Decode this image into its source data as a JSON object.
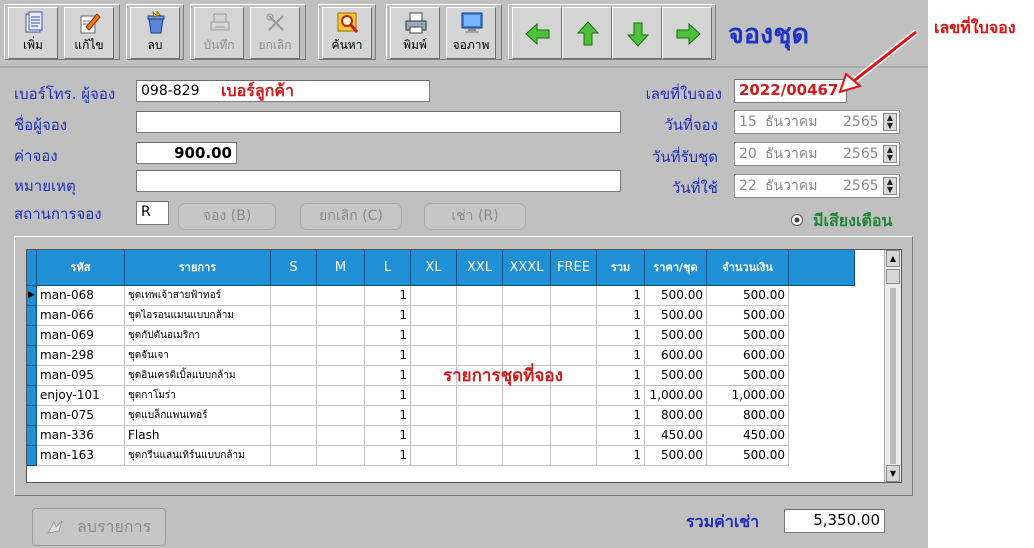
{
  "toolbar": {
    "buttons": [
      {
        "id": "add",
        "label": "เพิ่ม",
        "icon": "document-list-icon",
        "enabled": true
      },
      {
        "id": "edit",
        "label": "แก้ไข",
        "icon": "edit-pen-icon",
        "enabled": true
      },
      {
        "id": "delete",
        "label": "ลบ",
        "icon": "trash-can-icon",
        "enabled": true
      },
      {
        "id": "save",
        "label": "บันทึก",
        "icon": "printer-save-icon",
        "enabled": false
      },
      {
        "id": "cancel",
        "label": "ยกเลิก",
        "icon": "cross-tools-icon",
        "enabled": false
      },
      {
        "id": "search",
        "label": "ค้นหา",
        "icon": "magnifier-icon",
        "enabled": true
      },
      {
        "id": "print",
        "label": "พิมพ์",
        "icon": "printer-icon",
        "enabled": true
      },
      {
        "id": "screen",
        "label": "จอภาพ",
        "icon": "monitor-icon",
        "enabled": true
      }
    ],
    "nav": [
      {
        "id": "first",
        "icon": "arrow-left-icon"
      },
      {
        "id": "prev",
        "icon": "arrow-up-icon"
      },
      {
        "id": "next",
        "icon": "arrow-down-icon"
      },
      {
        "id": "last",
        "icon": "arrow-right-icon"
      }
    ]
  },
  "window_title": "จองชุด",
  "annotation": "เลขที่ใบจอง",
  "form": {
    "phone_label": "เบอร์โทร. ผู้จอง",
    "phone_value": "098-829",
    "phone_hint": "เบอร์ลูกค้า",
    "name_label": "ชื่อผู้จอง",
    "name_value": "",
    "deposit_label": "ค่าจอง",
    "deposit_value": "900.00",
    "note_label": "หมายเหตุ",
    "note_value": "",
    "status_label": "สถานการจอง",
    "status_value": "R",
    "btn_book": "จอง (B)",
    "btn_cancel": "ยกเลิก (C)",
    "btn_rent": "เช่า (R)",
    "doc_no_label": "เลขที่ใบจอง",
    "doc_no_value": "2022/00467",
    "date_book_label": "วันที่จอง",
    "date_book": {
      "day": "15",
      "month": "ธันวาคม",
      "year": "2565"
    },
    "date_pickup_label": "วันที่รับชุด",
    "date_pickup": {
      "day": "20",
      "month": "ธันวาคม",
      "year": "2565"
    },
    "date_use_label": "วันที่ใช้",
    "date_use": {
      "day": "22",
      "month": "ธันวาคม",
      "year": "2565"
    },
    "alert_label": "มีเสียงเตือน"
  },
  "grid": {
    "headers": [
      "รหัส",
      "รายการ",
      "S",
      "M",
      "L",
      "XL",
      "XXL",
      "XXXL",
      "FREE",
      "รวม",
      "ราคา/ชุด",
      "จำนวนเงิน"
    ],
    "rows": [
      {
        "code": "man-068",
        "name": "ชุดเทพเจ้าสายฟ้าทอร์",
        "S": "",
        "M": "",
        "L": "1",
        "XL": "",
        "XXL": "",
        "XXXL": "",
        "FREE": "",
        "total": "1",
        "price": "500.00",
        "amount": "500.00"
      },
      {
        "code": "man-066",
        "name": "ชุดไอรอนแมนแบบกล้าม",
        "S": "",
        "M": "",
        "L": "1",
        "XL": "",
        "XXL": "",
        "XXXL": "",
        "FREE": "",
        "total": "1",
        "price": "500.00",
        "amount": "500.00"
      },
      {
        "code": "man-069",
        "name": "ชุดกัปตันอเมริกา",
        "S": "",
        "M": "",
        "L": "1",
        "XL": "",
        "XXL": "",
        "XXXL": "",
        "FREE": "",
        "total": "1",
        "price": "500.00",
        "amount": "500.00"
      },
      {
        "code": "man-298",
        "name": "ชุดจันเจา",
        "S": "",
        "M": "",
        "L": "1",
        "XL": "",
        "XXL": "",
        "XXXL": "",
        "FREE": "",
        "total": "1",
        "price": "600.00",
        "amount": "600.00"
      },
      {
        "code": "man-095",
        "name": "ชุดอินเครดิเบิ้ลแบบกล้าม",
        "S": "",
        "M": "",
        "L": "1",
        "XL": "",
        "XXL": "",
        "XXXL": "",
        "FREE": "",
        "total": "1",
        "price": "500.00",
        "amount": "500.00"
      },
      {
        "code": "enjoy-101",
        "name": "ชุดกาโมร่า",
        "S": "",
        "M": "",
        "L": "1",
        "XL": "",
        "XXL": "",
        "XXXL": "",
        "FREE": "",
        "total": "1",
        "price": "1,000.00",
        "amount": "1,000.00"
      },
      {
        "code": "man-075",
        "name": "ชุดแบล็กแพนเทอร์",
        "S": "",
        "M": "",
        "L": "1",
        "XL": "",
        "XXL": "",
        "XXXL": "",
        "FREE": "",
        "total": "1",
        "price": "800.00",
        "amount": "800.00"
      },
      {
        "code": "man-336",
        "name": "Flash",
        "S": "",
        "M": "",
        "L": "1",
        "XL": "",
        "XXL": "",
        "XXXL": "",
        "FREE": "",
        "total": "1",
        "price": "450.00",
        "amount": "450.00"
      },
      {
        "code": "man-163",
        "name": "ชุดกรีนแลนเทิร์นแบบกล้าม",
        "S": "",
        "M": "",
        "L": "1",
        "XL": "",
        "XXL": "",
        "XXXL": "",
        "FREE": "",
        "total": "1",
        "price": "500.00",
        "amount": "500.00"
      }
    ],
    "overlay_label": "รายการชุดที่จอง"
  },
  "footer": {
    "delete_items_label": "ลบรายการ",
    "total_rent_label": "รวมค่าเช่า",
    "total_rent_value": "5,350.00"
  },
  "colors": {
    "header_blue": "#1f8fd6",
    "label_blue": "#1f2fb8",
    "title_blue": "#1e33c8",
    "red": "#d01c1c",
    "green": "#22863a"
  }
}
